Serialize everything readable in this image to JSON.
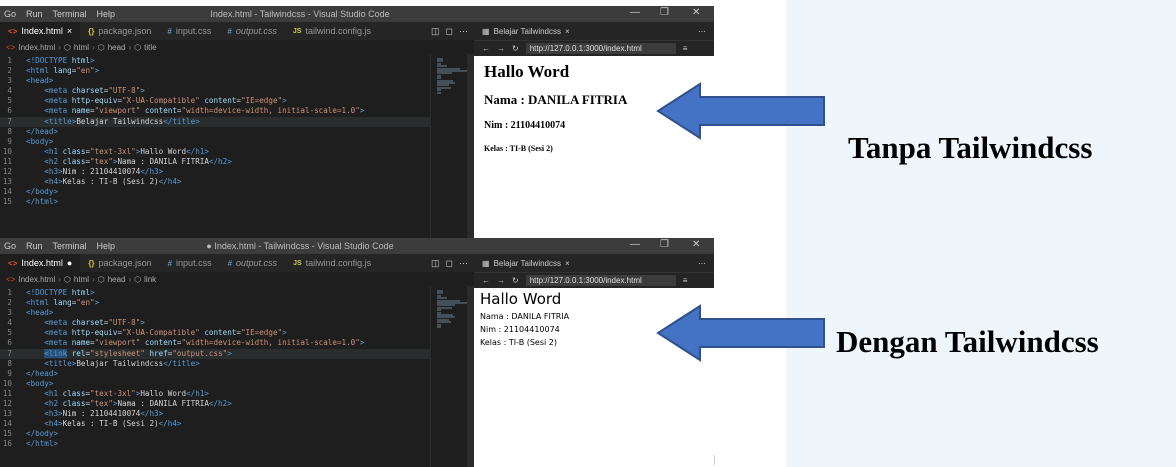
{
  "menu": [
    "Go",
    "Run",
    "Terminal",
    "Help"
  ],
  "tabs": [
    {
      "icon": "<>",
      "label": "Index.html"
    },
    {
      "icon": "{}",
      "label": "package.json"
    },
    {
      "icon": "#",
      "label": "input.css"
    },
    {
      "icon": "#",
      "label": "output.css"
    },
    {
      "icon": "JS",
      "label": "tailwind.config.js"
    }
  ],
  "browser": {
    "tab_label": "Belajar Tailwindcss",
    "url": "http://127.0.0.1:3000/index.html"
  },
  "page_content": {
    "h1": "Hallo Word",
    "h2": "Nama : DANILA FITRIA",
    "h3": "Nim : 21104410074",
    "h4": "Kelas : TI-B (Sesi 2)"
  },
  "top": {
    "window_title": "Index.html - Tailwindcss - Visual Studio Code",
    "active_tab_suffix": "×",
    "breadcrumb": [
      "Index.html",
      "html",
      "head",
      "title"
    ],
    "code_lines": [
      "<!DOCTYPE html>",
      "<html lang=\"en\">",
      "<head>",
      "    <meta charset=\"UTF-8\">",
      "    <meta http-equiv=\"X-UA-Compatible\" content=\"IE=edge\">",
      "    <meta name=\"viewport\" content=\"width=device-width, initial-scale=1.0\">",
      "    <title>Belajar Tailwindcss</title>",
      "</head>",
      "<body>",
      "    <h1 class=\"text-3xl\">Hallo Word</h1>",
      "    <h2 class=\"tex\">Nama : DANILA FITRIA</h2>",
      "    <h3>Nim : 21104410074</h3>",
      "    <h4>Kelas : TI-B (Sesi 2)</h4>",
      "</body>",
      "</html>"
    ],
    "current_line": 7,
    "annotation": "Tanpa Tailwindcss"
  },
  "bottom": {
    "window_title": "● Index.html - Tailwindcss - Visual Studio Code",
    "active_tab_suffix": "●",
    "breadcrumb": [
      "Index.html",
      "html",
      "head",
      "link"
    ],
    "code_lines": [
      "<!DOCTYPE html>",
      "<html lang=\"en\">",
      "<head>",
      "    <meta charset=\"UTF-8\">",
      "    <meta http-equiv=\"X-UA-Compatible\" content=\"IE=edge\">",
      "    <meta name=\"viewport\" content=\"width=device-width, initial-scale=1.0\">",
      "    <link rel=\"stylesheet\" href=\"output.css\">",
      "    <title>Belajar Tailwindcss</title>",
      "</head>",
      "<body>",
      "    <h1 class=\"text-3xl\">Hallo Word</h1>",
      "    <h2 class=\"tex\">Nama : DANILA FITRIA</h2>",
      "    <h3>Nim : 21104410074</h3>",
      "    <h4>Kelas : TI-B (Sesi 2)</h4>",
      "</body>",
      "</html>"
    ],
    "current_line": 7,
    "annotation": "Dengan Tailwindcss"
  },
  "colors": {
    "arrow_fill": "#4472c4",
    "arrow_stroke": "#2f528f",
    "editor_bg": "#1e1e1e",
    "tag": "#569cd6",
    "attr": "#9cdcfe",
    "string": "#ce9178"
  }
}
